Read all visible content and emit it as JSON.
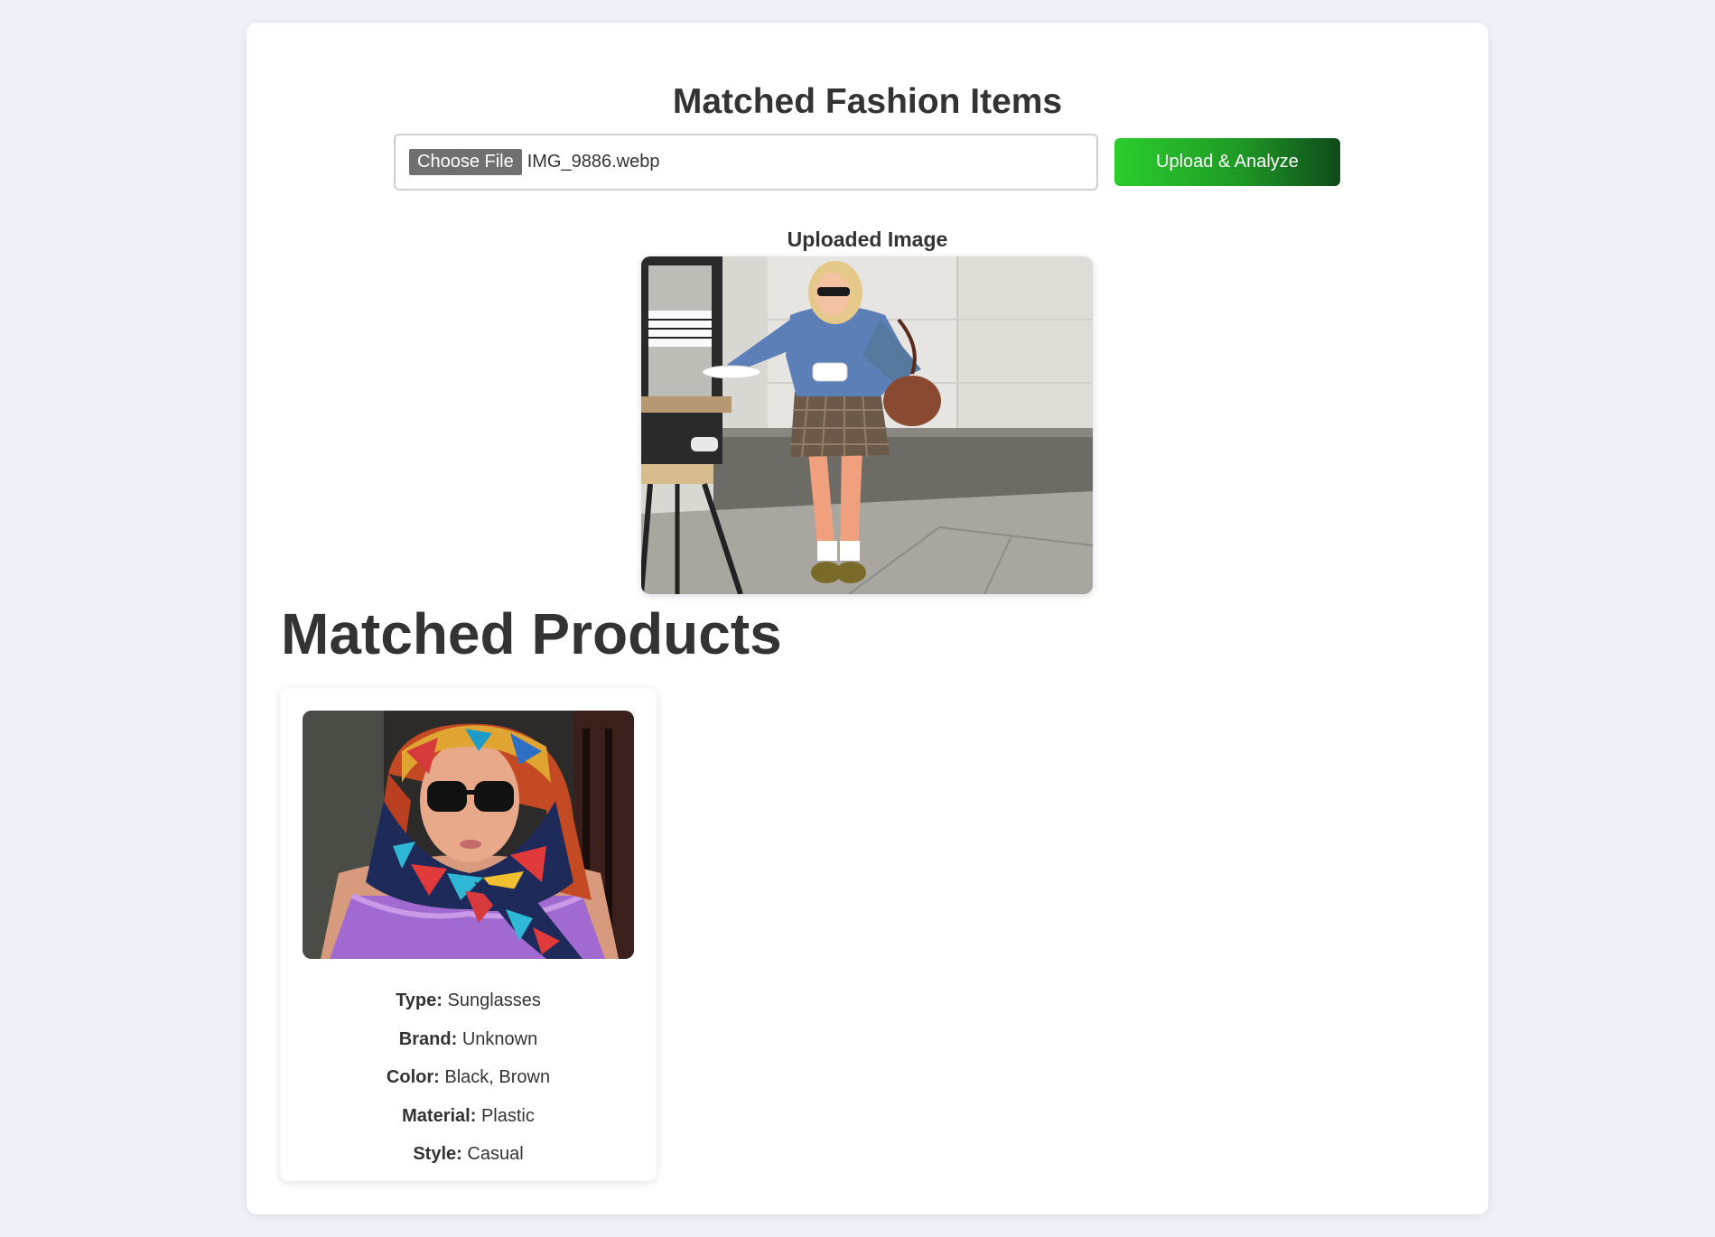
{
  "page": {
    "title": "Matched Fashion Items"
  },
  "upload": {
    "choose_label": "Choose File",
    "file_name": "IMG_9886.webp",
    "submit_label": "Upload & Analyze"
  },
  "uploaded": {
    "heading": "Uploaded Image"
  },
  "products": {
    "section_title": "Matched Products",
    "items": [
      {
        "attributes": [
          {
            "label": "Type:",
            "value": "Sunglasses"
          },
          {
            "label": "Brand:",
            "value": "Unknown"
          },
          {
            "label": "Color:",
            "value": "Black, Brown"
          },
          {
            "label": "Material:",
            "value": "Plastic"
          },
          {
            "label": "Style:",
            "value": "Casual"
          }
        ]
      }
    ]
  },
  "colors": {
    "background": "#eef1f8",
    "card": "#ffffff",
    "button_gradient_start": "#2ccd2c",
    "button_gradient_end": "#0f4a1b",
    "choose_button": "#707070"
  }
}
